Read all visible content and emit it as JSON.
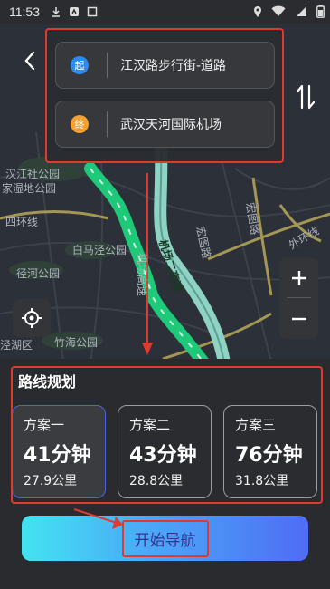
{
  "status_bar": {
    "time": "11:53"
  },
  "route": {
    "start_badge": "起",
    "start": "江汉路步行街-道路",
    "end_badge": "终",
    "end": "武汉天河国际机场"
  },
  "map": {
    "labels": [
      "汉江社公园",
      "家湿地公园",
      "四环线",
      "白马泾公园",
      "径河公园",
      "宏图路",
      "机场二高速",
      "机场高速",
      "泾湖区",
      "竹海公园",
      "宏图路",
      "外环线"
    ]
  },
  "planning": {
    "title": "路线规划",
    "options": [
      {
        "name": "方案一",
        "time": "41分钟",
        "distance": "27.9公里",
        "selected": true
      },
      {
        "name": "方案二",
        "time": "43分钟",
        "distance": "28.8公里",
        "selected": false
      },
      {
        "name": "方案三",
        "time": "76分钟",
        "distance": "31.8公里",
        "selected": false
      }
    ]
  },
  "start_nav": {
    "label": "开始导航"
  },
  "colors": {
    "highlight": "#e03a2f",
    "route_main": "#1ec97a",
    "route_alt": "#8fd3c4",
    "start_dot": "#2a8cf2",
    "end_dot": "#f5a033"
  }
}
